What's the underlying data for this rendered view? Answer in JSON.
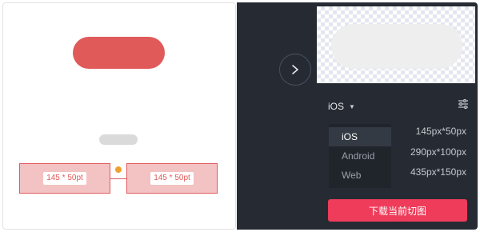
{
  "canvas": {
    "left_measure_label": "145 * 50pt",
    "right_measure_label": "145 * 50pt"
  },
  "panel": {
    "nav_icon": "chevron-right-icon",
    "platform_select": {
      "label": "iOS",
      "icon": "caret-down-icon"
    },
    "settings_icon": "sliders-icon",
    "platforms": [
      {
        "label": "iOS",
        "active": true
      },
      {
        "label": "Android",
        "active": false
      },
      {
        "label": "Web",
        "active": false
      }
    ],
    "sizes": [
      "145px*50px",
      "290px*100px",
      "435px*150px"
    ],
    "download_button": "下载当前切图"
  },
  "colors": {
    "accent_red": "#e05a5a",
    "download_button": "#ee3c5a",
    "panel_bg": "#262b33",
    "marker_orange": "#f0a030"
  }
}
